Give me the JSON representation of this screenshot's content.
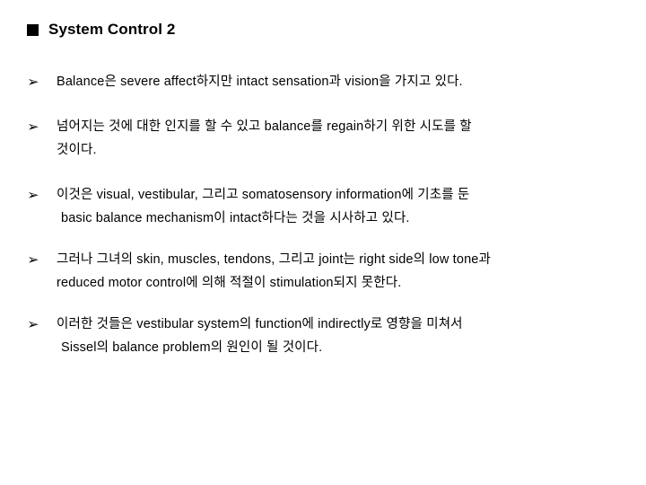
{
  "slide": {
    "title": {
      "bullet_icon": "black-square-bullet",
      "text": "System Control 2"
    },
    "bullet_icon": "wingdings-arrowhead-bullet",
    "bullet_glyph": "➢",
    "colors": {
      "background": "#ffffff",
      "text": "#000000",
      "title_bullet": "#000000"
    },
    "bullets": [
      {
        "marker": "➢",
        "lines": [
          "Balance은 severe affect하지만 intact sensation과 vision을 가지고 있다."
        ]
      },
      {
        "marker": "➢",
        "lines": [
          "넘어지는 것에 대한 인지를 할 수 있고 balance를 regain하기 위한 시도를 할",
          "것이다."
        ]
      },
      {
        "marker": "➢",
        "lines": [
          "이것은 visual, vestibular, 그리고 somatosensory information에 기초를 둔",
          "basic balance mechanism이 intact하다는 것을 시사하고 있다."
        ]
      },
      {
        "marker": "➢",
        "lines": [
          "그러나 그녀의 skin, muscles, tendons, 그리고 joint는 right side의 low tone과",
          "reduced motor control에 의해 적절이 stimulation되지 못한다."
        ]
      },
      {
        "marker": "➢",
        "lines": [
          "이러한 것들은 vestibular system의 function에 indirectly로 영향을 미쳐서",
          "Sissel의 balance problem의 원인이 될 것이다."
        ]
      }
    ]
  }
}
